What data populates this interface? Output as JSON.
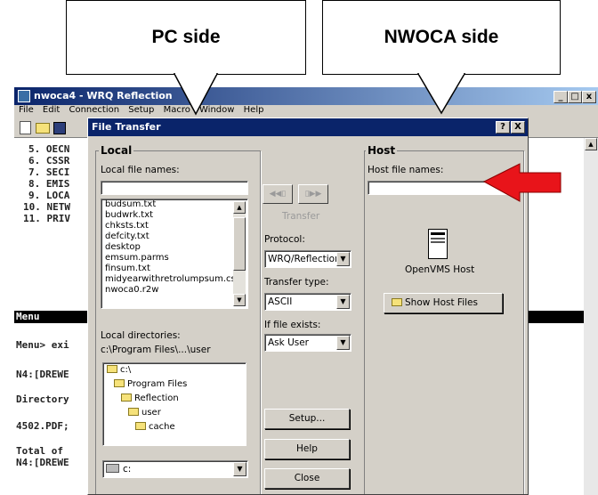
{
  "callouts": {
    "pc": "PC side",
    "host": "NWOCA side"
  },
  "app": {
    "title": "nwoca4 - WRQ Reflection",
    "menu": [
      "File",
      "Edit",
      "Connection",
      "Setup",
      "Macro",
      "Window",
      "Help"
    ],
    "window_controls": [
      "_",
      "□",
      "x"
    ]
  },
  "terminal": {
    "lines": [
      "5. OECN",
      "6. CSSR",
      "7. SECI",
      "8. EMIS",
      "9. LOCA",
      "10. NETW",
      "11. PRIV"
    ],
    "menu_bar": "Menu",
    "lines2": [
      "Menu> exi",
      "N4:[DREWE",
      "Directory",
      "4502.PDF;",
      "Total of",
      "N4:[DREWE"
    ]
  },
  "dialog": {
    "title": "File Transfer",
    "help_btn": "?",
    "close_btn": "X",
    "local": {
      "group": "Local",
      "file_names_label": "Local file names:",
      "file_name_value": "",
      "files": [
        "budsum.txt",
        "budwrk.txt",
        "chksts.txt",
        "defcity.txt",
        "desktop",
        "emsum.parms",
        "finsum.txt",
        "midyearwithretrolumpsum.csv",
        "nwoca0.r2w"
      ],
      "directories_label": "Local directories:",
      "current_dir": "c:\\Program Files\\...\\user",
      "dirs": [
        "c:\\",
        "Program Files",
        "Reflection",
        "user",
        "cache"
      ],
      "drive": "c:"
    },
    "middle": {
      "transfer_label": "Transfer",
      "protocol_label": "Protocol:",
      "protocol_value": "WRQ/Reflection",
      "transfer_type_label": "Transfer type:",
      "transfer_type_value": "ASCII",
      "if_exists_label": "If file exists:",
      "if_exists_value": "Ask User",
      "setup_btn": "Setup...",
      "help_btn": "Help",
      "close_btn": "Close"
    },
    "host": {
      "group": "Host",
      "file_names_label": "Host file names:",
      "file_name_value": "",
      "system_label": "OpenVMS Host",
      "show_files_btn": "Show Host Files"
    }
  },
  "colors": {
    "arrow": "#e8141a",
    "titlebar": "#0a246a",
    "face": "#d4d0c8"
  }
}
